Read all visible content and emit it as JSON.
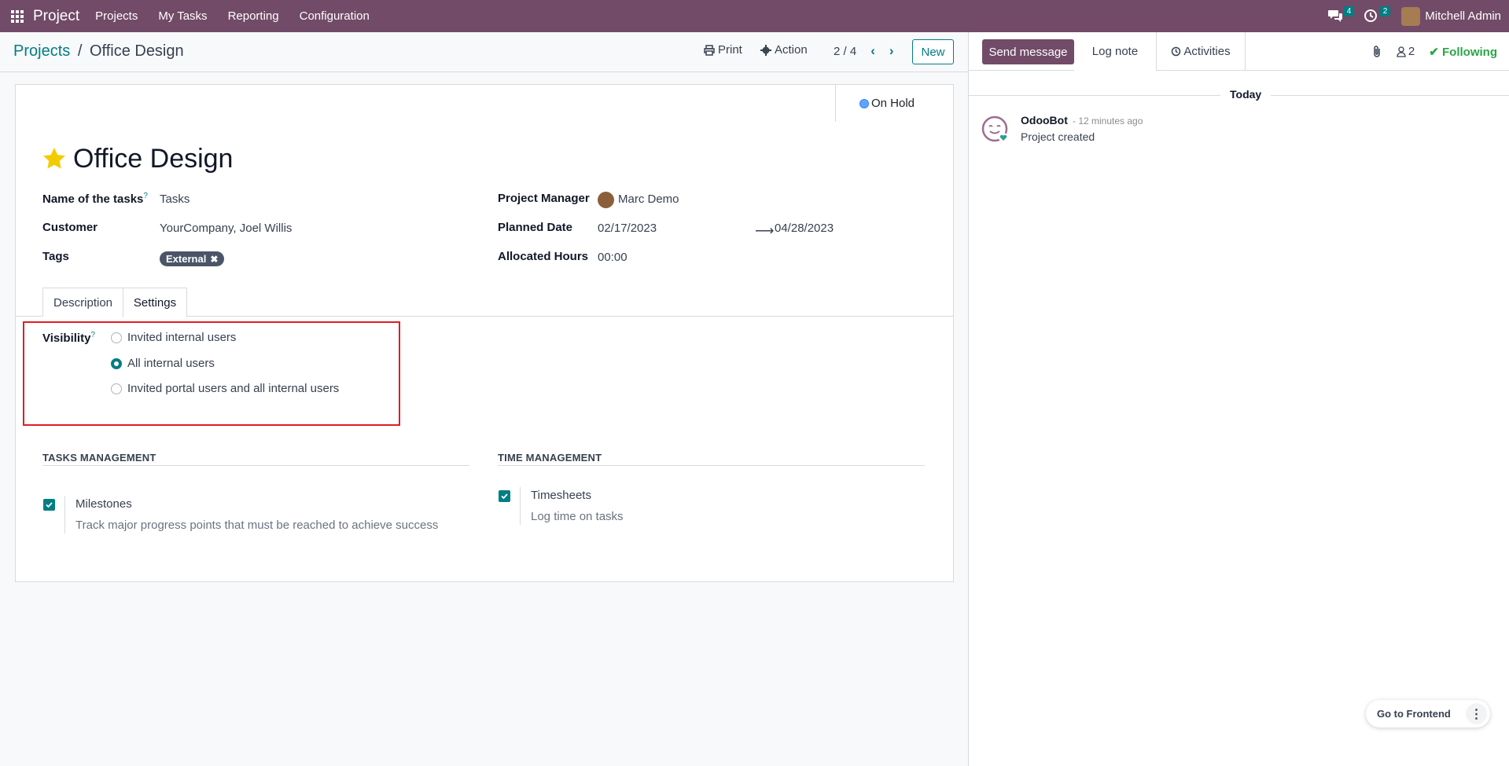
{
  "navbar": {
    "app_name": "Project",
    "menu": [
      "Projects",
      "My Tasks",
      "Reporting",
      "Configuration"
    ],
    "messages_count": "4",
    "activities_count": "2",
    "user_name": "Mitchell Admin"
  },
  "control_panel": {
    "breadcrumb_parent": "Projects",
    "breadcrumb_separator": "/",
    "breadcrumb_current": "Office Design",
    "print_label": "Print",
    "action_label": "Action",
    "pager": "2 / 4",
    "new_label": "New"
  },
  "status": {
    "label": "On Hold",
    "color": "#60a5fa"
  },
  "form": {
    "title": "Office Design",
    "fields": {
      "name_of_tasks_label": "Name of the tasks",
      "name_of_tasks_help": "?",
      "name_of_tasks_value": "Tasks",
      "customer_label": "Customer",
      "customer_value": "YourCompany, Joel Willis",
      "tags_label": "Tags",
      "tag_value": "External",
      "project_manager_label": "Project Manager",
      "project_manager_value": "Marc Demo",
      "planned_date_label": "Planned Date",
      "planned_date_start": "02/17/2023",
      "planned_date_end": "04/28/2023",
      "allocated_hours_label": "Allocated Hours",
      "allocated_hours_value": "00:00"
    },
    "tabs": [
      "Description",
      "Settings"
    ],
    "active_tab": "Settings",
    "visibility": {
      "label": "Visibility",
      "help": "?",
      "options": [
        "Invited internal users",
        "All internal users",
        "Invited portal users and all internal users"
      ],
      "selected": "All internal users"
    },
    "tasks_management": {
      "title": "TASKS MANAGEMENT",
      "option_title": "Milestones",
      "option_desc": "Track major progress points that must be reached to achieve success",
      "checked": true
    },
    "time_management": {
      "title": "TIME MANAGEMENT",
      "option_title": "Timesheets",
      "option_desc": "Log time on tasks",
      "checked": true
    }
  },
  "chatter": {
    "send_message": "Send message",
    "log_note": "Log note",
    "activities": "Activities",
    "followers_count": "2",
    "following": "Following",
    "date_separator": "Today",
    "message": {
      "author": "OdooBot",
      "time": "- 12 minutes ago",
      "body": "Project created"
    }
  },
  "go_to_frontend": "Go to Frontend",
  "colors": {
    "brand": "#714b67",
    "accent": "#017e84",
    "highlight_box": "#e11d24"
  }
}
